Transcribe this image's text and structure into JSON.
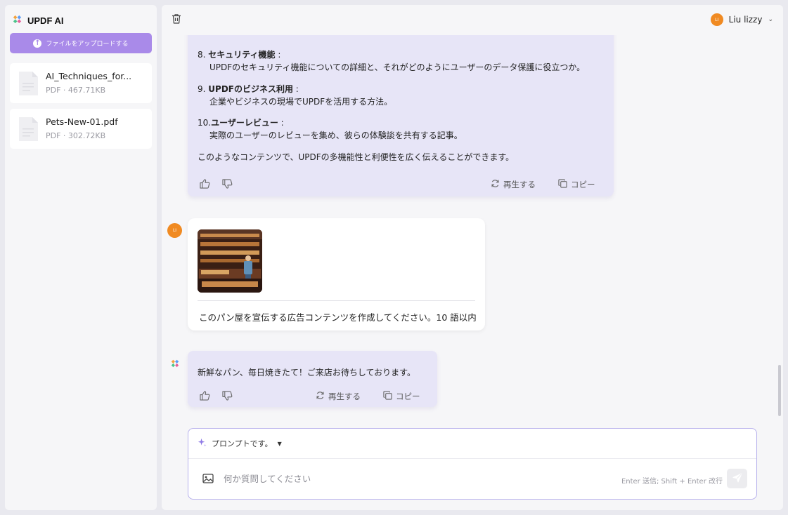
{
  "sidebar": {
    "brand": "UPDF AI",
    "upload_label": "ファイルをアップロードする",
    "files": [
      {
        "name": "AI_Techniques_for...",
        "meta": "PDF · 467.71KB"
      },
      {
        "name": "Pets-New-01.pdf",
        "meta": "PDF · 302.72KB"
      }
    ]
  },
  "header": {
    "user_initials": "LI",
    "user_name": "Liu lizzy"
  },
  "chat": {
    "ai1": {
      "item8_num": "8.",
      "item8_title": "セキュリティ機能",
      "item8_colon": " :",
      "item8_desc": "UPDFのセキュリティ機能についての詳細と、それがどのようにユーザーのデータ保護に役立つか。",
      "item9_num": "9.",
      "item9_title": "UPDFのビジネス利用",
      "item9_colon": " :",
      "item9_desc": "企業やビジネスの現場でUPDFを活用する方法。",
      "item10_num": "10.",
      "item10_title": "ユーザーレビュー",
      "item10_colon": " :",
      "item10_desc": "実際のユーザーのレビューを集め、彼らの体験談を共有する記事。",
      "conclusion": "このようなコンテンツで、UPDFの多機能性と利便性を広く伝えることができます。",
      "regenerate": "再生する",
      "copy": "コピー"
    },
    "user_msg": {
      "avatar": "LI",
      "text": "このパン屋を宣伝する広告コンテンツを作成してください。10 語以内"
    },
    "ai2": {
      "text": "新鮮なパン、毎日焼きたて！ご来店お待ちしております。",
      "regenerate": "再生する",
      "copy": "コピー"
    }
  },
  "composer": {
    "prompt_label": "プロンプトです。",
    "placeholder": "何か質問してください",
    "hint": "Enter 送信; Shift + Enter 改行"
  },
  "colors": {
    "accent": "#a98ae9",
    "ai_bubble": "#e7e5f7",
    "avatar": "#f08a22"
  }
}
